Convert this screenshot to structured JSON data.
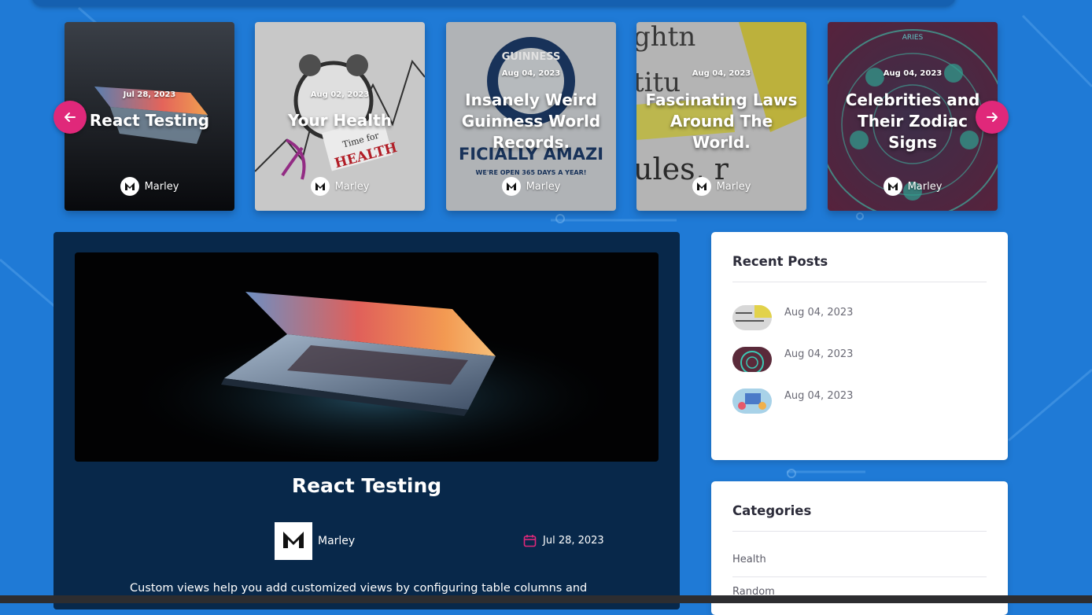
{
  "carousel": {
    "prev_icon": "arrow-left-icon",
    "next_icon": "arrow-right-icon",
    "cards": [
      {
        "date": "Jul 28, 2023",
        "title": "React Testing",
        "author": "Marley"
      },
      {
        "date": "Aug 02, 2023",
        "title": "Your Health",
        "author": "Marley"
      },
      {
        "date": "Aug 04, 2023",
        "title": "Insanely Weird Guinness World Records.",
        "author": "Marley"
      },
      {
        "date": "Aug 04, 2023",
        "title": "Fascinating Laws Around The World.",
        "author": "Marley"
      },
      {
        "date": "Aug 04, 2023",
        "title": "Celebrities and Their Zodiac Signs",
        "author": "Marley"
      }
    ],
    "art_text": {
      "health_caption": "Time for",
      "health_word": "HEALTH",
      "guinness_text": "GUINNESS",
      "records_banner": "FICIALLY AMAZI",
      "open_line": "WE'RE OPEN 365 DAYS A YEAR!",
      "laws_text": "ules, r",
      "zodiac_top": "ARIES"
    }
  },
  "post": {
    "title": "React Testing",
    "author": "Marley",
    "date": "Jul 28, 2023",
    "excerpt": "Custom views help you add customized views by configuring table columns and"
  },
  "sidebar": {
    "recent_posts": {
      "heading": "Recent Posts",
      "items": [
        {
          "date": "Aug 04, 2023"
        },
        {
          "date": "Aug 04, 2023"
        },
        {
          "date": "Aug 04, 2023"
        }
      ]
    },
    "categories": {
      "heading": "Categories",
      "items": [
        "Health",
        "Random"
      ]
    }
  },
  "colors": {
    "page_bg": "#1f7ad6",
    "accent": "#e0287a",
    "post_bg": "#08284a"
  }
}
